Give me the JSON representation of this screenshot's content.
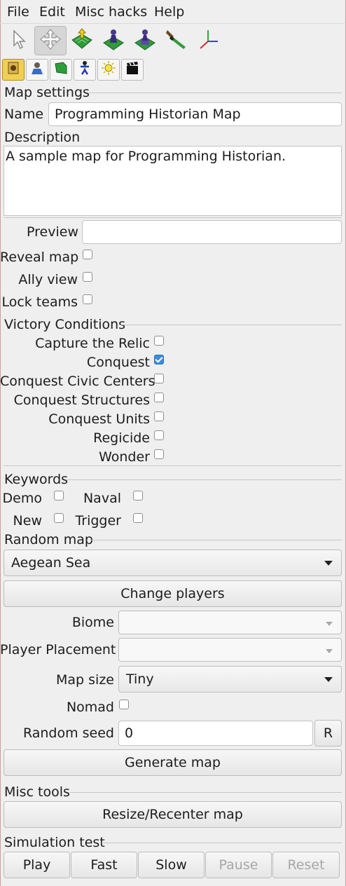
{
  "menu": {
    "file": "File",
    "edit": "Edit",
    "misc_hacks": "Misc hacks",
    "help": "Help"
  },
  "toolbar": {
    "tools": [
      "select-cursor-icon",
      "move-icon",
      "terrain-elevation-icon",
      "unit-piece-icon",
      "place-unit-icon",
      "paint-brush-icon",
      "axes-gizmo-icon"
    ],
    "active_tool": "move-icon",
    "tabs": [
      "map-settings-icon",
      "player-icon",
      "terrain-icon",
      "actor-icon",
      "lighting-icon",
      "cinematic-icon"
    ],
    "active_tab": "map-settings-icon"
  },
  "map_settings": {
    "title": "Map settings",
    "name_label": "Name",
    "name_value": "Programming Historian Map",
    "description_label": "Description",
    "description_value": "A sample map for Programming Historian.",
    "preview_label": "Preview",
    "preview_value": "",
    "reveal_map_label": "Reveal map",
    "reveal_map_checked": false,
    "ally_view_label": "Ally view",
    "ally_view_checked": false,
    "lock_teams_label": "Lock teams",
    "lock_teams_checked": false
  },
  "victory": {
    "title": "Victory Conditions",
    "conditions": [
      {
        "label": "Capture the Relic",
        "checked": false
      },
      {
        "label": "Conquest",
        "checked": true
      },
      {
        "label": "Conquest Civic Centers",
        "checked": false
      },
      {
        "label": "Conquest Structures",
        "checked": false
      },
      {
        "label": "Conquest Units",
        "checked": false
      },
      {
        "label": "Regicide",
        "checked": false
      },
      {
        "label": "Wonder",
        "checked": false
      }
    ]
  },
  "keywords": {
    "title": "Keywords",
    "items": [
      {
        "label": "Demo",
        "checked": false
      },
      {
        "label": "Naval",
        "checked": false
      },
      {
        "label": "New",
        "checked": false
      },
      {
        "label": "Trigger",
        "checked": false
      }
    ]
  },
  "random_map": {
    "title": "Random map",
    "script_selected": "Aegean Sea",
    "change_players_label": "Change players",
    "biome_label": "Biome",
    "biome_value": "",
    "placement_label": "Player Placement",
    "placement_value": "",
    "map_size_label": "Map size",
    "map_size_value": "Tiny",
    "nomad_label": "Nomad",
    "nomad_checked": false,
    "seed_label": "Random seed",
    "seed_value": "0",
    "reseed_label": "R",
    "generate_label": "Generate map"
  },
  "misc_tools": {
    "title": "Misc tools",
    "resize_label": "Resize/Recenter map"
  },
  "simulation": {
    "title": "Simulation test",
    "play_label": "Play",
    "fast_label": "Fast",
    "slow_label": "Slow",
    "pause_label": "Pause",
    "reset_label": "Reset"
  },
  "colors": {
    "check_accent": "#3a8fdb",
    "active_tab": "#f2cf52",
    "frame": "#c8a0a0"
  }
}
